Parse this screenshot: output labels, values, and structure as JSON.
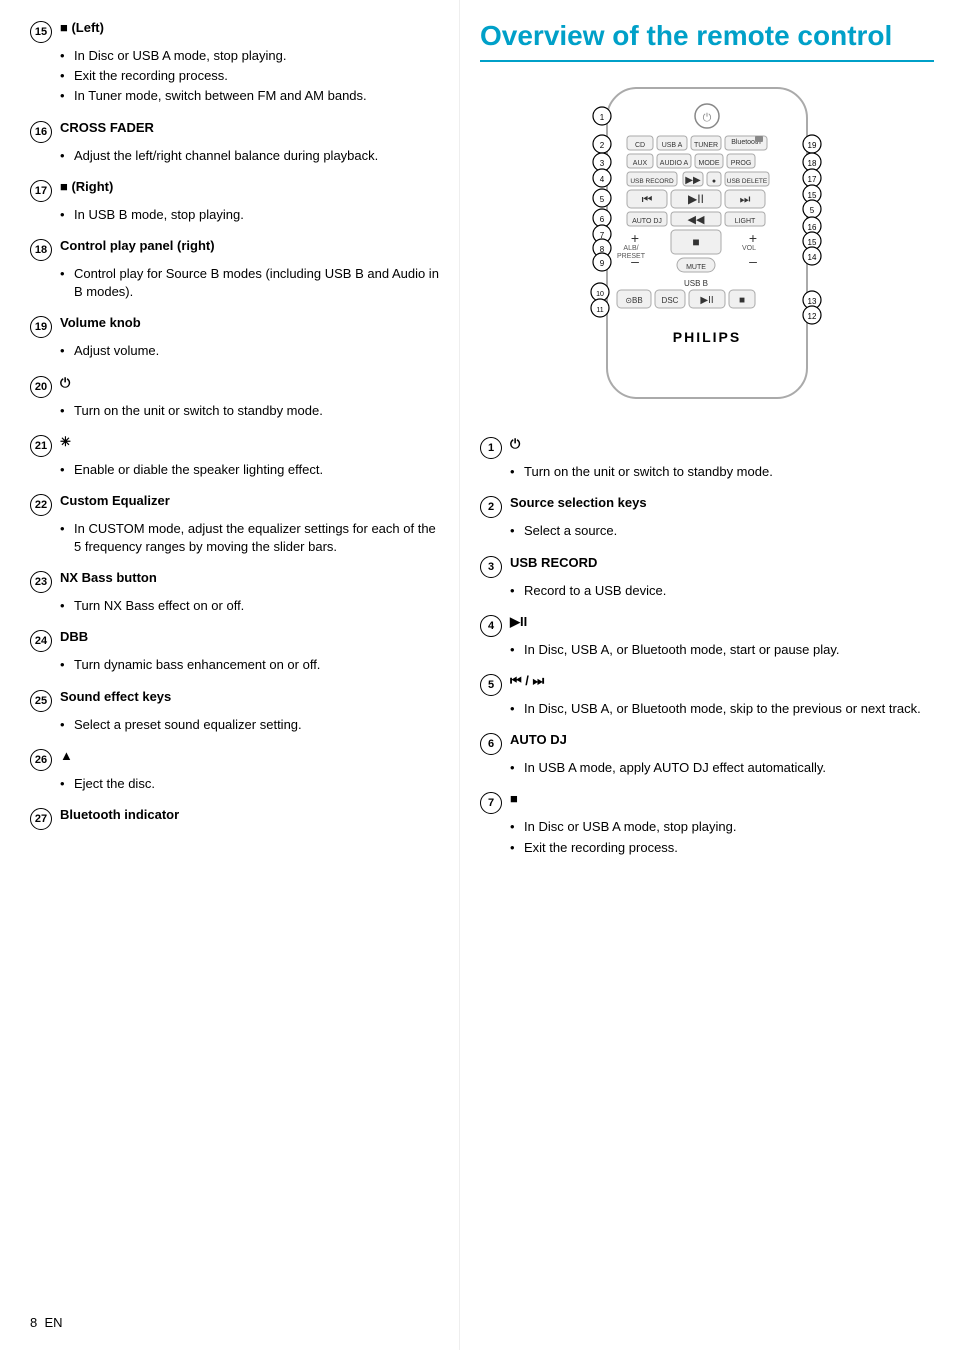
{
  "page_number": "8",
  "lang": "EN",
  "left_sections": [
    {
      "num": "15",
      "header": "■ (Left)",
      "bullets": [
        "In Disc or USB A mode, stop playing.",
        "Exit the recording process.",
        "In Tuner mode, switch between FM and AM bands."
      ]
    },
    {
      "num": "16",
      "header": "CROSS FADER",
      "bullets": [
        "Adjust the left/right channel balance during playback."
      ]
    },
    {
      "num": "17",
      "header": "■ (Right)",
      "bullets": [
        "In USB B mode, stop playing."
      ]
    },
    {
      "num": "18",
      "header": "Control play panel (right)",
      "bullets": [
        "Control play for Source B modes (including USB B and Audio in B modes)."
      ]
    },
    {
      "num": "19",
      "header": "Volume knob",
      "bullets": [
        "Adjust volume."
      ]
    },
    {
      "num": "20",
      "header": "⏻",
      "bullets": [
        "Turn on the unit or switch to standby mode."
      ]
    },
    {
      "num": "21",
      "header": "✳",
      "bullets": [
        "Enable or diable the speaker lighting effect."
      ]
    },
    {
      "num": "22",
      "header": "Custom Equalizer",
      "bullets": [
        "In CUSTOM mode, adjust the equalizer settings for each of the 5 frequency ranges by moving the slider bars."
      ]
    },
    {
      "num": "23",
      "header": "NX Bass button",
      "bullets": [
        "Turn NX Bass effect on or off."
      ]
    },
    {
      "num": "24",
      "header": "DBB",
      "bullets": [
        "Turn dynamic bass enhancement on or off."
      ]
    },
    {
      "num": "25",
      "header": "Sound effect keys",
      "bullets": [
        "Select a preset sound equalizer setting."
      ]
    },
    {
      "num": "26",
      "header": "▲",
      "bullets": [
        "Eject the disc."
      ]
    },
    {
      "num": "27",
      "header": "Bluetooth indicator",
      "bullets": []
    }
  ],
  "right_title": "Overview of the remote control",
  "right_sections": [
    {
      "num": "1",
      "symbol": "⏻",
      "header": "",
      "bullets": [
        "Turn on the unit or switch to standby mode."
      ]
    },
    {
      "num": "2",
      "header": "Source selection keys",
      "bullets": [
        "Select a source."
      ]
    },
    {
      "num": "3",
      "header": "USB RECORD",
      "bullets": [
        "Record to a USB device."
      ]
    },
    {
      "num": "4",
      "header": "▶II",
      "bullets": [
        "In Disc, USB A, or Bluetooth mode, start or pause play."
      ]
    },
    {
      "num": "5",
      "header": "⏮ / ⏭",
      "bullets": [
        "In Disc, USB A, or Bluetooth mode, skip to the previous or next track."
      ]
    },
    {
      "num": "6",
      "header": "AUTO DJ",
      "bullets": [
        "In USB A mode, apply AUTO DJ effect automatically."
      ]
    },
    {
      "num": "7",
      "header": "■",
      "bullets": [
        "In Disc or USB A mode, stop playing.",
        "Exit the recording process."
      ]
    }
  ],
  "remote": {
    "label": "PHILIPS",
    "numbered_labels": [
      "1",
      "2",
      "3",
      "4",
      "5",
      "6",
      "7",
      "8",
      "9",
      "10",
      "11",
      "12",
      "13",
      "14",
      "15",
      "16",
      "17",
      "18",
      "19"
    ],
    "rows": [
      {
        "items": [
          "CD",
          "USB A",
          "TUNER",
          "Bluetooth"
        ]
      },
      {
        "items": [
          "AUX",
          "AUDIO A",
          "MODE",
          "PROG"
        ]
      },
      {
        "items": [
          "USB RECORD",
          "",
          "",
          "USB DELETE"
        ]
      },
      {
        "items": [
          "●",
          "▶▶",
          ""
        ]
      },
      {
        "items": [
          "⏮",
          "▶II",
          "⏭"
        ]
      },
      {
        "items": [
          "AUTO DJ",
          "◀◀",
          "LIGHT"
        ]
      },
      {
        "items": [
          "■",
          ""
        ]
      },
      {
        "items": [
          "+",
          "■",
          "+"
        ]
      },
      {
        "items": [
          "ALB/PRESET",
          "",
          "VOL"
        ]
      },
      {
        "items": [
          "–",
          "MUTE",
          "–"
        ]
      },
      {
        "items": [
          "",
          "USB B",
          ""
        ]
      },
      {
        "items": [
          "⊙BB",
          "DSC",
          "▶II",
          "■"
        ]
      }
    ]
  }
}
